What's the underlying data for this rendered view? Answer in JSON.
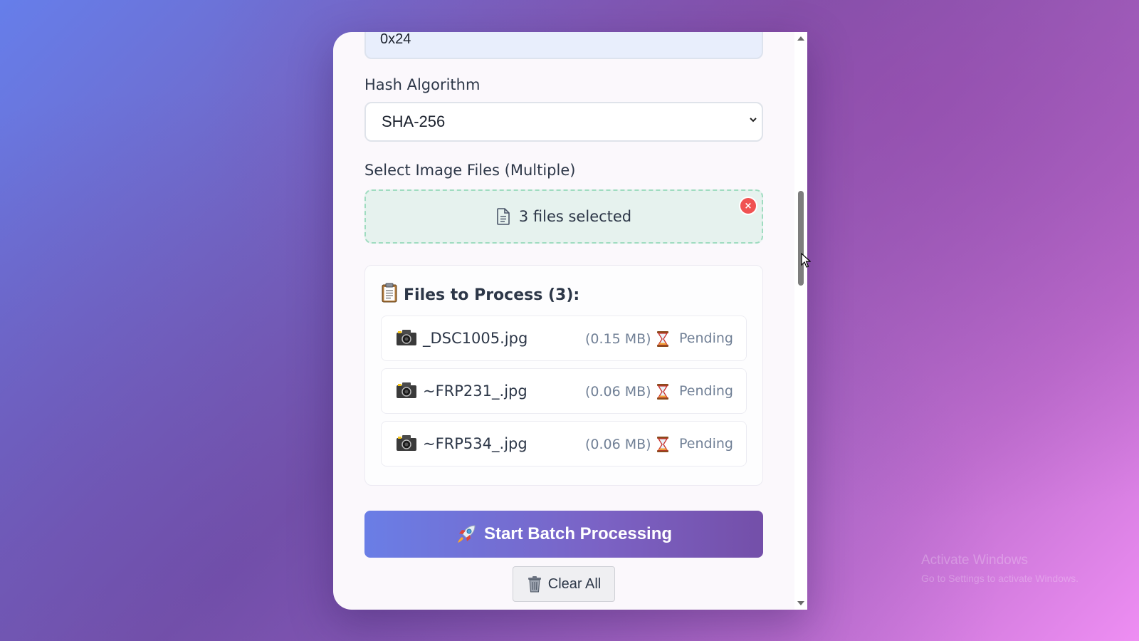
{
  "form": {
    "top_input_value": "0x24",
    "hash_label": "Hash Algorithm",
    "hash_selected": "SHA-256",
    "files_label": "Select Image Files (Multiple)",
    "dropzone_text": "3 files selected",
    "dropzone_clear": "×"
  },
  "files_panel": {
    "title": "Files to Process (3):",
    "files": [
      {
        "name": "_DSC1005.jpg",
        "size": "(0.15 MB)",
        "status": "Pending"
      },
      {
        "name": "~FRP231_.jpg",
        "size": "(0.06 MB)",
        "status": "Pending"
      },
      {
        "name": "~FRP534_.jpg",
        "size": "(0.06 MB)",
        "status": "Pending"
      }
    ]
  },
  "actions": {
    "start_label": "Start Batch Processing",
    "clear_label": "Clear All"
  },
  "watermark": {
    "line1": "Activate Windows",
    "line2": "Go to Settings to activate Windows."
  },
  "colors": {
    "accent_start": "#6a7ee6",
    "accent_end": "#744fa9",
    "dropzone_bg": "#e6f2ee",
    "clear_badge": "#f05252"
  }
}
